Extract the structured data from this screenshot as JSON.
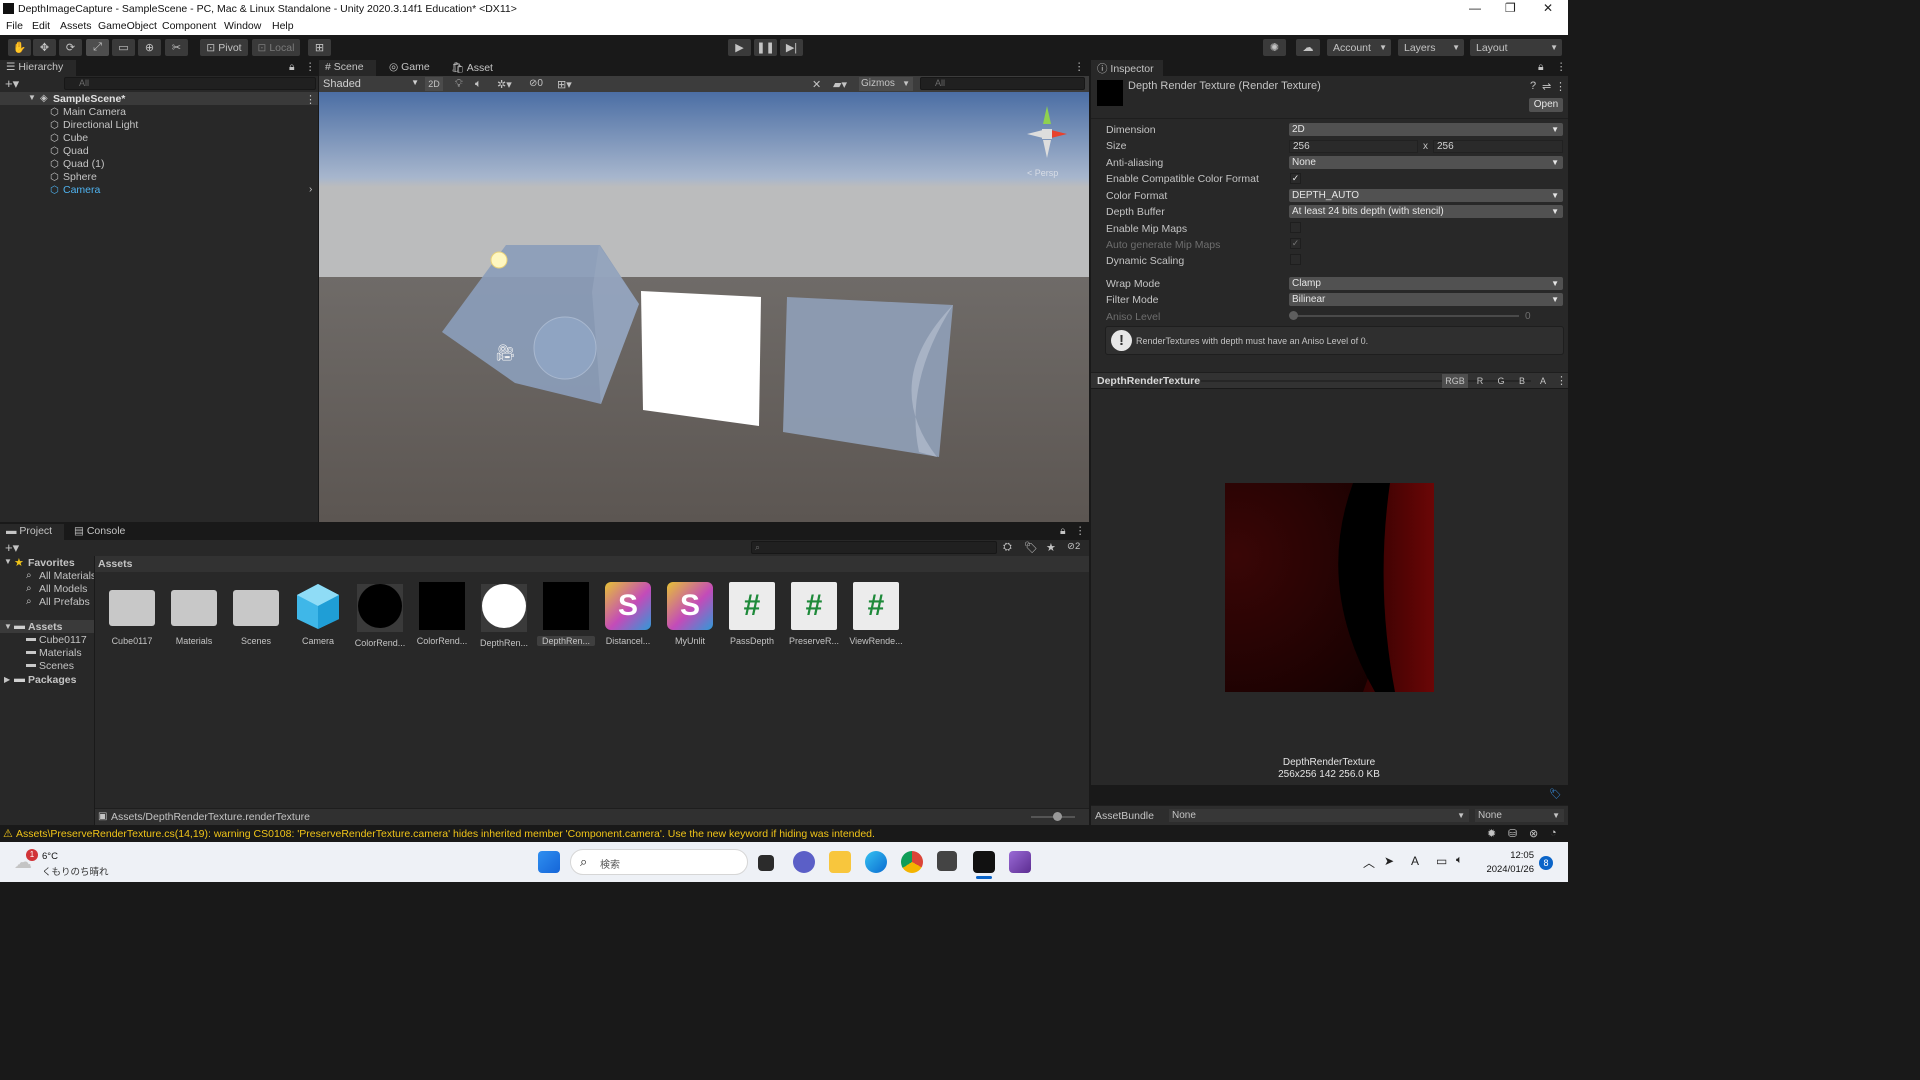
{
  "window": {
    "title": "DepthImageCapture - SampleScene - PC, Mac & Linux Standalone - Unity 2020.3.14f1 Education* <DX11>"
  },
  "menu": [
    "File",
    "Edit",
    "Assets",
    "GameObject",
    "Component",
    "Window",
    "Help"
  ],
  "toolbar": {
    "pivot": "Pivot",
    "local": "Local",
    "account": "Account",
    "layers": "Layers",
    "layout": "Layout"
  },
  "hierarchy": {
    "tab": "Hierarchy",
    "search": "All",
    "scene": "SampleScene*",
    "items": [
      "Main Camera",
      "Directional Light",
      "Cube",
      "Quad",
      "Quad (1)",
      "Sphere",
      "Camera"
    ]
  },
  "scene": {
    "tabs": [
      "Scene",
      "Game",
      "Asset Store"
    ],
    "shading": "Shaded",
    "mode2d": "2D",
    "hidden_count": "0",
    "gizmos": "Gizmos",
    "search": "All",
    "persp": "< Persp"
  },
  "inspector": {
    "tab": "Inspector",
    "asset_title": "Depth Render Texture (Render Texture)",
    "open": "Open",
    "labels": {
      "dimension": "Dimension",
      "size": "Size",
      "anti_aliasing": "Anti-aliasing",
      "compat": "Enable Compatible Color Format",
      "color_format": "Color Format",
      "depth_buffer": "Depth Buffer",
      "mipmaps": "Enable Mip Maps",
      "auto_mip": "Auto generate Mip Maps",
      "dynamic_scaling": "Dynamic Scaling",
      "wrap": "Wrap Mode",
      "filter": "Filter Mode",
      "aniso": "Aniso Level"
    },
    "values": {
      "dimension": "2D",
      "size_w": "256",
      "size_x": "x",
      "size_h": "256",
      "anti_aliasing": "None",
      "color_format": "DEPTH_AUTO",
      "depth_buffer": "At least 24 bits depth (with stencil)",
      "wrap": "Clamp",
      "filter": "Bilinear",
      "aniso": "0"
    },
    "checks": {
      "compat": true,
      "mipmaps": false,
      "auto_mip": true,
      "dynamic_scaling": false
    },
    "warning": "RenderTextures with depth must have an Aniso Level of 0.",
    "preview_title": "DepthRenderTexture",
    "channels": [
      "RGB",
      "R",
      "G",
      "B",
      "A"
    ],
    "preview_name": "DepthRenderTexture",
    "preview_info": "256x256  142  256.0 KB",
    "assetbundle_label": "AssetBundle",
    "assetbundle_value": "None",
    "assetbundle_variant": "None"
  },
  "project": {
    "tabs": [
      "Project",
      "Console"
    ],
    "favorites": "Favorites",
    "fav_items": [
      "All Materials",
      "All Models",
      "All Prefabs"
    ],
    "assets_root": "Assets",
    "asset_folders": [
      "Cube0117",
      "Materials",
      "Scenes"
    ],
    "packages": "Packages",
    "breadcrumb": "Assets",
    "items": [
      {
        "label": "Cube0117",
        "kind": "folder"
      },
      {
        "label": "Materials",
        "kind": "folder"
      },
      {
        "label": "Scenes",
        "kind": "folder"
      },
      {
        "label": "Camera",
        "kind": "prefab"
      },
      {
        "label": "ColorRend...",
        "kind": "material-black-sphere"
      },
      {
        "label": "ColorRend...",
        "kind": "rt-black"
      },
      {
        "label": "DepthRen...",
        "kind": "material-white-sphere"
      },
      {
        "label": "DepthRen...",
        "kind": "rt-black"
      },
      {
        "label": "Distancel...",
        "kind": "shader"
      },
      {
        "label": "MyUnlit",
        "kind": "shader"
      },
      {
        "label": "PassDepth",
        "kind": "script"
      },
      {
        "label": "PreserveR...",
        "kind": "script"
      },
      {
        "label": "ViewRende...",
        "kind": "script"
      }
    ],
    "hidden_count": "2",
    "path": "Assets/DepthRenderTexture.renderTexture"
  },
  "console_warning": "Assets\\PreserveRenderTexture.cs(14,19): warning CS0108: 'PreserveRenderTexture.camera' hides inherited member 'Component.camera'. Use the new keyword if hiding was intended.",
  "taskbar": {
    "weather_temp": "6°C",
    "weather_desc": "くもりのち晴れ",
    "weather_badge": "1",
    "search": "検索",
    "time": "12:05",
    "date": "2024/01/26",
    "notif": "8",
    "ime": "A"
  }
}
